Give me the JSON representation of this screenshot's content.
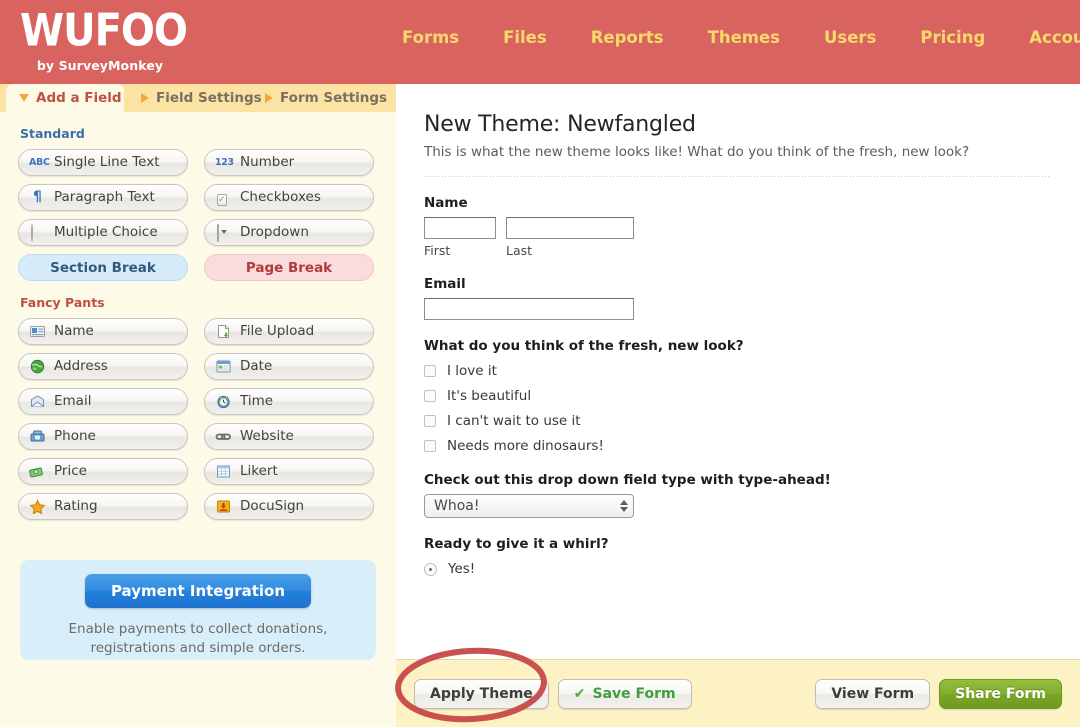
{
  "header": {
    "logo_word": "WUFOO",
    "logo_tagline": "by SurveyMonkey",
    "brand_color": "#d9645f",
    "nav_color": "#f6d86b",
    "nav": [
      {
        "label": "Forms"
      },
      {
        "label": "Files"
      },
      {
        "label": "Reports"
      },
      {
        "label": "Themes"
      },
      {
        "label": "Users"
      },
      {
        "label": "Pricing"
      },
      {
        "label": "Account",
        "has_caret": true
      }
    ]
  },
  "tabs": [
    {
      "label": "Add a Field",
      "active": true,
      "marker": "triangle-down"
    },
    {
      "label": "Field Settings",
      "active": false,
      "marker": "triangle-right"
    },
    {
      "label": "Form Settings",
      "active": false,
      "marker": "triangle-right"
    }
  ],
  "sidebar": {
    "background": "#fdfbe8",
    "standard": {
      "heading": "Standard",
      "heading_color": "#3a6ea8",
      "fields": [
        {
          "label": "Single Line Text",
          "icon": "abc-icon"
        },
        {
          "label": "Number",
          "icon": "123-icon"
        },
        {
          "label": "Paragraph Text",
          "icon": "pilcrow-icon"
        },
        {
          "label": "Checkboxes",
          "icon": "checkbox-icon"
        },
        {
          "label": "Multiple Choice",
          "icon": "radio-circle-icon"
        },
        {
          "label": "Dropdown",
          "icon": "dropdown-icon"
        },
        {
          "label": "Section Break",
          "icon": "none",
          "style": "section-break"
        },
        {
          "label": "Page Break",
          "icon": "none",
          "style": "page-break"
        }
      ],
      "abc_glyph": "ABC",
      "num_glyph": "123",
      "pilcrow_glyph": "¶",
      "check_glyph": "✓"
    },
    "fancy": {
      "heading": "Fancy Pants",
      "heading_color": "#c0503f",
      "fields": [
        {
          "label": "Name",
          "icon": "contact-card-icon"
        },
        {
          "label": "File Upload",
          "icon": "file-upload-icon"
        },
        {
          "label": "Address",
          "icon": "globe-icon"
        },
        {
          "label": "Date",
          "icon": "calendar-icon"
        },
        {
          "label": "Email",
          "icon": "envelope-icon"
        },
        {
          "label": "Time",
          "icon": "alarm-clock-icon"
        },
        {
          "label": "Phone",
          "icon": "telephone-icon"
        },
        {
          "label": "Website",
          "icon": "chain-link-icon"
        },
        {
          "label": "Price",
          "icon": "money-icon"
        },
        {
          "label": "Likert",
          "icon": "table-grid-icon"
        },
        {
          "label": "Rating",
          "icon": "star-icon"
        },
        {
          "label": "DocuSign",
          "icon": "download-arrow-icon"
        }
      ]
    },
    "payment": {
      "button_label": "Payment Integration",
      "description_line1": "Enable payments to collect donations,",
      "description_line2": "registrations and simple orders.",
      "panel_color": "#d9eefb",
      "button_color": "#2380dc"
    }
  },
  "form": {
    "title": "New Theme: Newfangled",
    "description": "This is what the new theme looks like! What do you think of the fresh, new look?",
    "name_field": {
      "label": "Name",
      "first_value": "",
      "last_value": "",
      "first_sublabel": "First",
      "last_sublabel": "Last"
    },
    "email_field": {
      "label": "Email",
      "value": ""
    },
    "checkbox_question": {
      "label": "What do you think of the fresh, new look?",
      "options": [
        {
          "label": "I love it",
          "checked": false
        },
        {
          "label": "It's beautiful",
          "checked": false
        },
        {
          "label": "I can't wait to use it",
          "checked": false
        },
        {
          "label": "Needs more dinosaurs!",
          "checked": false
        }
      ]
    },
    "dropdown_question": {
      "label": "Check out this drop down field type with type-ahead!",
      "selected": "Whoa!"
    },
    "radio_question": {
      "label": "Ready to give it a whirl?",
      "options": [
        {
          "label": "Yes!",
          "selected": true
        }
      ]
    }
  },
  "footer": {
    "background": "#fcf2c4",
    "apply_theme": "Apply Theme",
    "save_form": "Save Form",
    "save_check_glyph": "✔",
    "view_form": "View Form",
    "share_form": "Share Form",
    "share_color": "#7aa628"
  },
  "annotation": {
    "shape": "ellipse",
    "color": "#c9514f",
    "target": "Apply Theme"
  }
}
